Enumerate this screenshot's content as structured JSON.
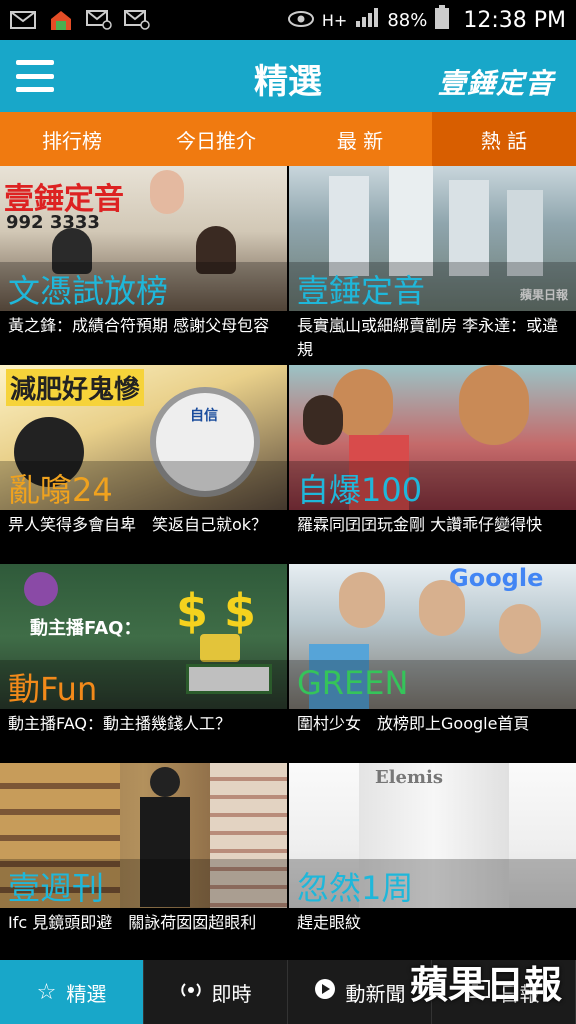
{
  "status_bar": {
    "icons_left": [
      "mail-icon",
      "image-icon",
      "mail-at-icon",
      "mail-at-icon-2"
    ],
    "network": "H+",
    "battery": "88%",
    "time": "12:38 PM"
  },
  "app_bar": {
    "title": "精選",
    "brand": "壹錘定音"
  },
  "tabs": [
    {
      "label": "排行榜"
    },
    {
      "label": "今日推介"
    },
    {
      "label": "最 新"
    },
    {
      "label": "熱 話"
    }
  ],
  "tiles": [
    {
      "category": "文憑試放榜",
      "caption": "黃之鋒：成績合符預期 感謝父母包容",
      "image_text": "壹錘定音",
      "image_subtext": "992 3333"
    },
    {
      "category": "壹錘定音",
      "caption": "長實嵐山或細綁賣劏房 李永達：或違規",
      "image_text": "蘋果日報"
    },
    {
      "category": "亂噏24",
      "caption": "畀人笑得多會自卑　笑返自己就ok？",
      "image_text": "減肥好鬼慘",
      "image_subtext": "自信"
    },
    {
      "category": "自爆100",
      "caption": "羅霖同囝囝玩金剛 大讚乖仔變得快"
    },
    {
      "category": "動Fun",
      "caption": "動主播FAQ：動主播幾錢人工？",
      "image_text": "動主播FAQ：",
      "image_subtext": "$ $"
    },
    {
      "category": "GREEN",
      "caption": "圍村少女　放榜即上Google首頁",
      "image_text": "Google"
    },
    {
      "category": "壹週刊",
      "caption": "Ifc 見鏡頭即避　關詠荷囡囡超眼利"
    },
    {
      "category": "忽然1周",
      "caption": "趕走眼紋",
      "image_text": "Elemis"
    }
  ],
  "bottom_nav": [
    {
      "label": "精選",
      "icon": "star-icon"
    },
    {
      "label": "即時",
      "icon": "radio-icon"
    },
    {
      "label": "動新聞",
      "icon": "play-icon"
    },
    {
      "label": "日報",
      "icon": "newspaper-icon"
    }
  ],
  "watermark": "蘋果日報",
  "colors": {
    "app_bar": "#18a7c9",
    "tab_bar": "#f07a10",
    "tab_active": "#d85e00",
    "nav_active": "#18a7c9"
  }
}
